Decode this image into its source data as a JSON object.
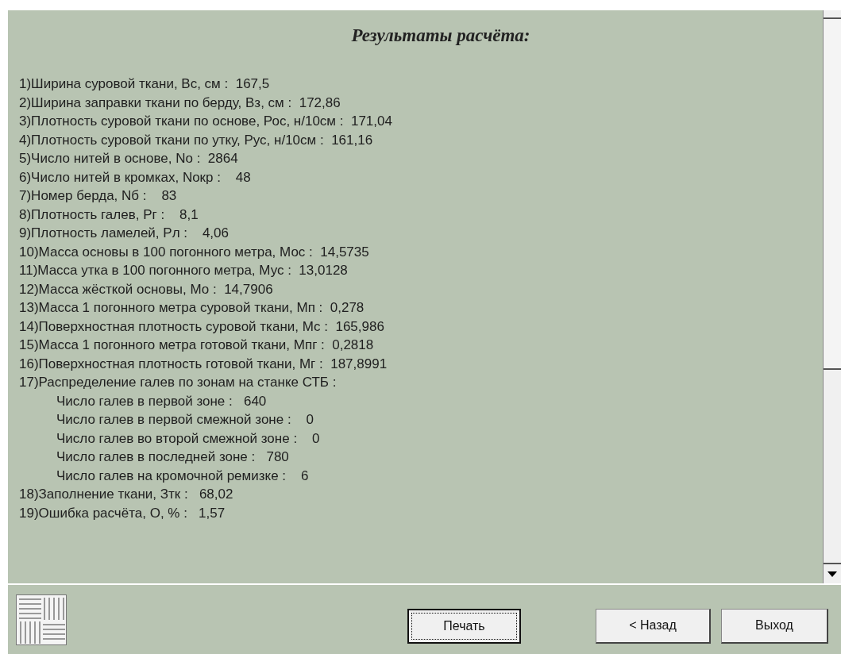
{
  "title": "Результаты расчёта:",
  "results": [
    {
      "text": "1)Ширина суровой ткани, Вс, см :  167,5"
    },
    {
      "text": "2)Ширина заправки ткани по берду, Вз, см :  172,86"
    },
    {
      "text": "3)Плотность суровой ткани по основе, Рос, н/10см :  171,04"
    },
    {
      "text": "4)Плотность суровой ткани по утку, Рус, н/10см :  161,16"
    },
    {
      "text": "5)Число нитей в основе, No :  2864"
    },
    {
      "text": "6)Число нитей в кромках, Nокр :    48"
    },
    {
      "text": "7)Номер берда, Nб :    83"
    },
    {
      "text": "8)Плотность галев, Рг :    8,1"
    },
    {
      "text": "9)Плотность ламелей, Рл :    4,06"
    },
    {
      "text": "10)Масса основы в 100 погонного метра, Мос :  14,5735"
    },
    {
      "text": "11)Масса утка в 100 погонного метра, Мус :  13,0128"
    },
    {
      "text": "12)Масса жёсткой основы, Мо :  14,7906"
    },
    {
      "text": "13)Масса 1 погонного метра суровой ткани, Мп :  0,278"
    },
    {
      "text": "14)Поверхностная плотность суровой ткани, Мс :  165,986"
    },
    {
      "text": "15)Масса 1 погонного метра готовой ткани, Мпг :  0,2818"
    },
    {
      "text": "16)Поверхностная плотность готовой ткани, Мг :  187,8991"
    },
    {
      "text": "17)Распределение галев по зонам на станке СТБ :",
      "children": [
        {
          "text": "Число галев в первой зоне :   640"
        },
        {
          "text": "Число галев в первой смежной зоне :    0"
        },
        {
          "text": "Число галев во второй смежной зоне :    0"
        },
        {
          "text": "Число галев в последней зоне :   780"
        },
        {
          "text": "Число галев на кромочной ремизке :    6"
        }
      ]
    },
    {
      "text": "18)Заполнение ткани, Зтк :   68,02"
    },
    {
      "text": "19)Ошибка расчёта, О, % :   1,57"
    }
  ],
  "buttons": [
    {
      "label": "Печать",
      "focused": true
    },
    {
      "label": "< Назад",
      "focused": false
    },
    {
      "label": "Выход",
      "focused": false
    }
  ]
}
